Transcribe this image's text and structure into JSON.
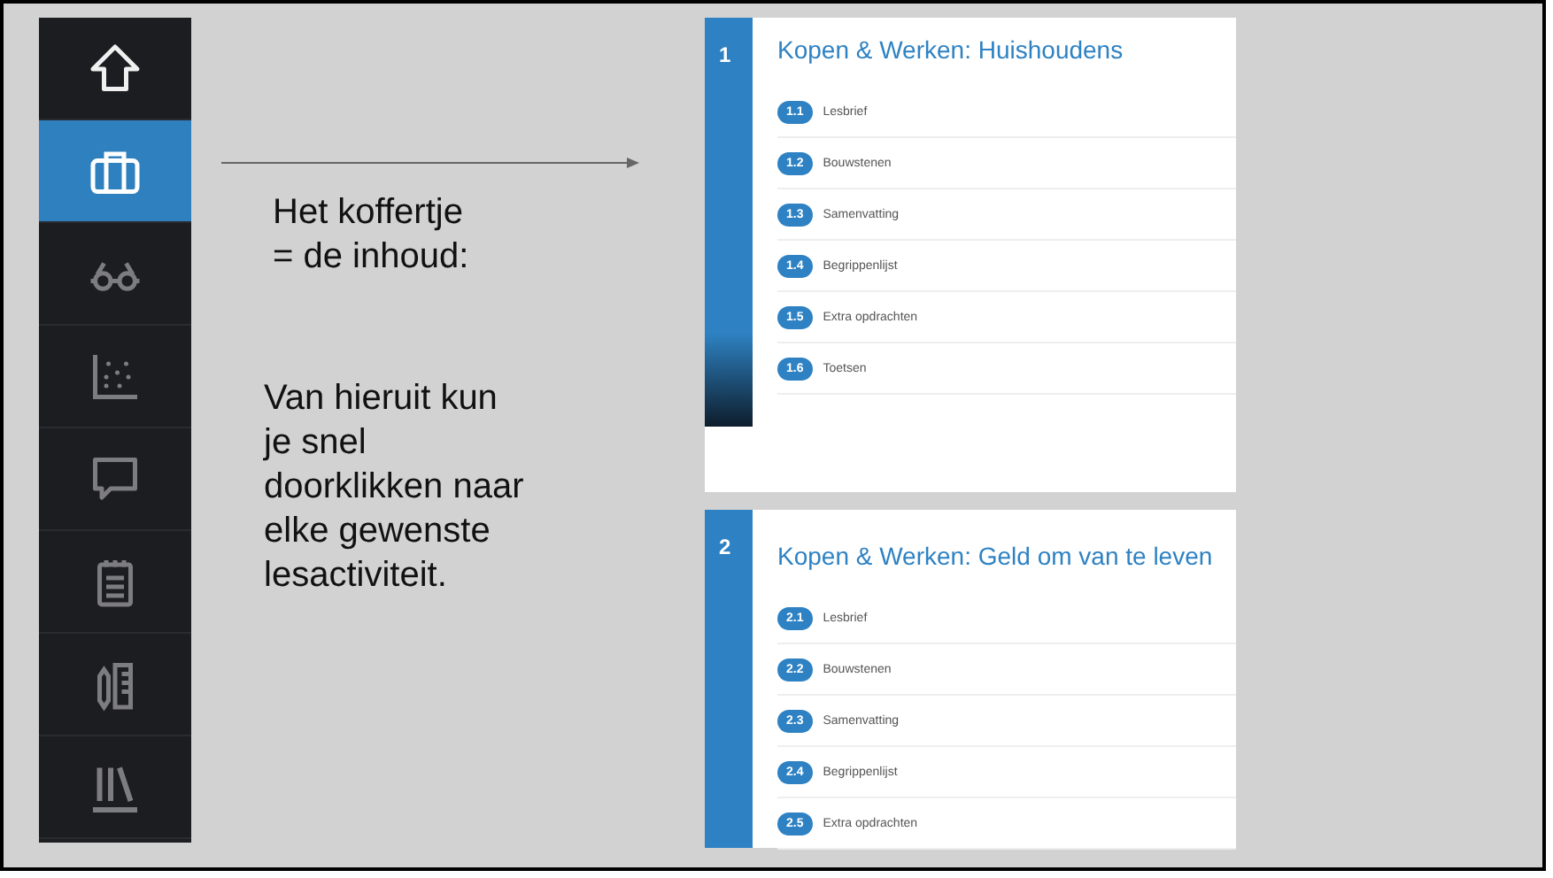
{
  "sidebar": {
    "items": [
      {
        "kind": "home",
        "selected": false
      },
      {
        "kind": "briefcase",
        "selected": true
      },
      {
        "kind": "glasses",
        "selected": false
      },
      {
        "kind": "scatter",
        "selected": false
      },
      {
        "kind": "chat",
        "selected": false
      },
      {
        "kind": "notepad",
        "selected": false
      },
      {
        "kind": "tools",
        "selected": false
      },
      {
        "kind": "library",
        "selected": false
      }
    ]
  },
  "explanation": {
    "heading_lines": [
      "Het koffertje",
      "=  de inhoud:"
    ],
    "body_lines": [
      "Van hieruit kun",
      "je snel",
      "doorklikken naar",
      "elke gewenste",
      "lesactiviteit."
    ]
  },
  "chapters": [
    {
      "number": "1",
      "title": "Kopen & Werken: Huishoudens",
      "lessons": [
        {
          "number": "1.1",
          "label": "Lesbrief"
        },
        {
          "number": "1.2",
          "label": "Bouwstenen"
        },
        {
          "number": "1.3",
          "label": "Samenvatting"
        },
        {
          "number": "1.4",
          "label": "Begrippenlijst"
        },
        {
          "number": "1.5",
          "label": "Extra opdrachten"
        },
        {
          "number": "1.6",
          "label": "Toetsen"
        }
      ]
    },
    {
      "number": "2",
      "title": "Kopen & Werken: Geld om van te leven",
      "lessons": [
        {
          "number": "2.1",
          "label": "Lesbrief"
        },
        {
          "number": "2.2",
          "label": "Bouwstenen"
        },
        {
          "number": "2.3",
          "label": "Samenvatting"
        },
        {
          "number": "2.4",
          "label": "Begrippenlijst"
        },
        {
          "number": "2.5",
          "label": "Extra opdrachten"
        }
      ]
    }
  ]
}
